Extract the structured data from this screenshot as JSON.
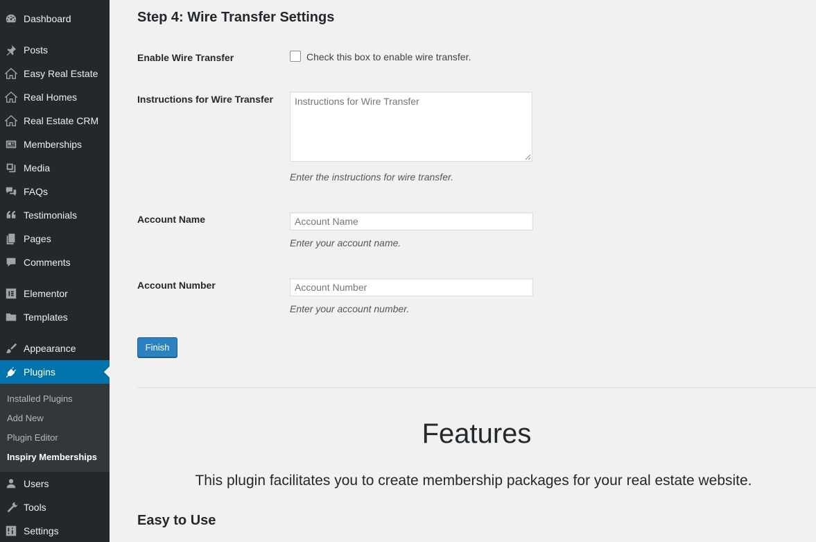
{
  "sidebar": {
    "items": [
      {
        "label": "Dashboard",
        "icon": "dashboard-icon"
      },
      {
        "label": "Posts",
        "icon": "pin-icon"
      },
      {
        "label": "Easy Real Estate",
        "icon": "house-icon"
      },
      {
        "label": "Real Homes",
        "icon": "house-icon"
      },
      {
        "label": "Real Estate CRM",
        "icon": "house-icon"
      },
      {
        "label": "Memberships",
        "icon": "id-card-icon"
      },
      {
        "label": "Media",
        "icon": "media-icon"
      },
      {
        "label": "FAQs",
        "icon": "chat-bubbles-icon"
      },
      {
        "label": "Testimonials",
        "icon": "quote-icon"
      },
      {
        "label": "Pages",
        "icon": "pages-icon"
      },
      {
        "label": "Comments",
        "icon": "comment-icon"
      },
      {
        "label": "Elementor",
        "icon": "elementor-icon"
      },
      {
        "label": "Templates",
        "icon": "folder-icon"
      },
      {
        "label": "Appearance",
        "icon": "brush-icon"
      },
      {
        "label": "Plugins",
        "icon": "plug-icon"
      },
      {
        "label": "Users",
        "icon": "user-icon"
      },
      {
        "label": "Tools",
        "icon": "wrench-icon"
      },
      {
        "label": "Settings",
        "icon": "settings-sliders-icon"
      }
    ],
    "submenu": [
      "Installed Plugins",
      "Add New",
      "Plugin Editor",
      "Inspiry Memberships"
    ],
    "accent": "#0073aa"
  },
  "main": {
    "step_title": "Step 4: Wire Transfer Settings",
    "enable": {
      "label": "Enable Wire Transfer",
      "checkbox_label": "Check this box to enable wire transfer."
    },
    "instructions": {
      "label": "Instructions for Wire Transfer",
      "placeholder": "Instructions for Wire Transfer",
      "description": "Enter the instructions for wire transfer."
    },
    "account_name": {
      "label": "Account Name",
      "placeholder": "Account Name",
      "description": "Enter your account name."
    },
    "account_number": {
      "label": "Account Number",
      "placeholder": "Account Number",
      "description": "Enter your account number."
    },
    "finish_label": "Finish"
  },
  "features": {
    "heading": "Features",
    "subtitle": "This plugin facilitates you to create membership packages for your real estate website.",
    "easy_heading": "Easy to Use"
  }
}
